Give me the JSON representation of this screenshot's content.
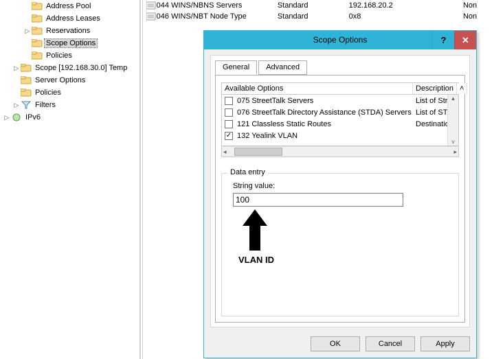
{
  "tree": {
    "items": [
      {
        "indent": "ind2",
        "expander": "",
        "icon": "folder",
        "label": "Address Pool",
        "selected": false
      },
      {
        "indent": "ind2",
        "expander": "",
        "icon": "folder",
        "label": "Address Leases",
        "selected": false
      },
      {
        "indent": "ind2",
        "expander": "▷",
        "icon": "folder",
        "label": "Reservations",
        "selected": false
      },
      {
        "indent": "ind2",
        "expander": "",
        "icon": "folder",
        "label": "Scope Options",
        "selected": true
      },
      {
        "indent": "ind2",
        "expander": "",
        "icon": "folder",
        "label": "Policies",
        "selected": false
      },
      {
        "indent": "ind1",
        "expander": "▷",
        "icon": "folder",
        "label": "Scope [192.168.30.0] Temp",
        "selected": false
      },
      {
        "indent": "ind1",
        "expander": "",
        "icon": "folder",
        "label": "Server Options",
        "selected": false
      },
      {
        "indent": "ind1",
        "expander": "",
        "icon": "folder",
        "label": "Policies",
        "selected": false
      },
      {
        "indent": "ind1",
        "expander": "▷",
        "icon": "filter",
        "label": "Filters",
        "selected": false
      },
      {
        "indent": "ind0",
        "expander": "▷",
        "icon": "ipv6",
        "label": "IPv6",
        "selected": false
      }
    ]
  },
  "list": {
    "rows": [
      {
        "name": "044 WINS/NBNS Servers",
        "vendor": "Standard",
        "value": "192.168.20.2",
        "class": "Non"
      },
      {
        "name": "046 WINS/NBT Node Type",
        "vendor": "Standard",
        "value": "0x8",
        "class": "Non"
      }
    ]
  },
  "dialog": {
    "title": "Scope Options",
    "help_glyph": "?",
    "close_glyph": "✕",
    "tabs": {
      "general": "General",
      "advanced": "Advanced"
    },
    "headers": {
      "available": "Available Options",
      "description": "Description"
    },
    "options": [
      {
        "checked": false,
        "name": "075 StreetTalk Servers",
        "desc": "List of Stree"
      },
      {
        "checked": false,
        "name": "076 StreetTalk Directory Assistance (STDA) Servers",
        "desc": "List of STDA"
      },
      {
        "checked": false,
        "name": "121 Classless Static Routes",
        "desc": "Destination,"
      },
      {
        "checked": true,
        "name": "132 Yealink VLAN",
        "desc": ""
      }
    ],
    "group_label": "Data entry",
    "field_label": "String value:",
    "field_value": "100",
    "annotation_text": "VLAN ID",
    "buttons": {
      "ok": "OK",
      "cancel": "Cancel",
      "apply": "Apply"
    }
  }
}
